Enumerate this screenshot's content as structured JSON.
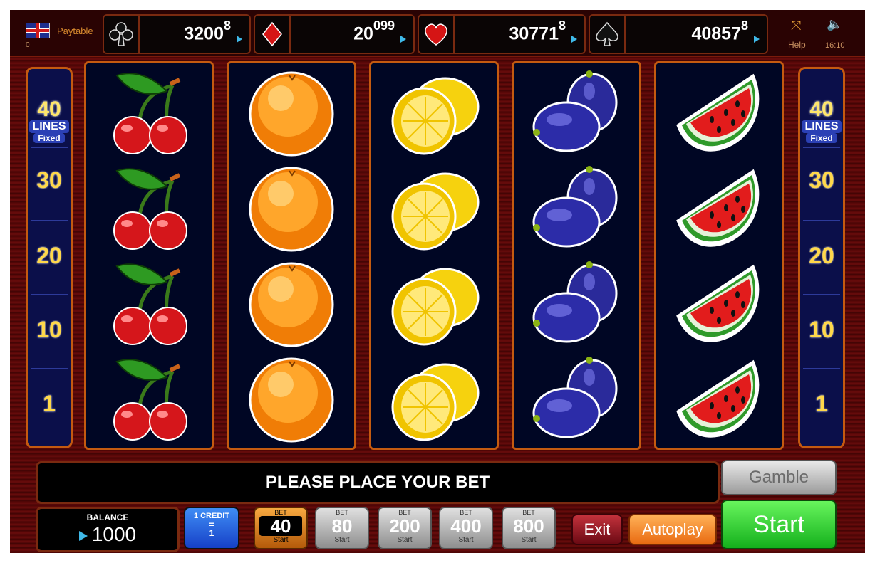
{
  "header": {
    "paytable_label": "Paytable",
    "credit_small": "0",
    "help_label": "Help",
    "time": "16:10",
    "fullscreen_icon": "fullscreen-icon",
    "sound_icon": "speaker-icon"
  },
  "jackpots": [
    {
      "suit": "club",
      "main": "3200",
      "sup": "8"
    },
    {
      "suit": "diamond",
      "main": "20",
      "sup": "099"
    },
    {
      "suit": "heart",
      "main": "30771",
      "sup": "8"
    },
    {
      "suit": "spade",
      "main": "40857",
      "sup": "8"
    }
  ],
  "lines_panel": {
    "top_number": "40",
    "lines_label": "LINES",
    "fixed_label": "Fixed",
    "levels": [
      "30",
      "20",
      "10",
      "1"
    ]
  },
  "reels": [
    {
      "symbol": "cherry"
    },
    {
      "symbol": "orange"
    },
    {
      "symbol": "lemon"
    },
    {
      "symbol": "plum"
    },
    {
      "symbol": "watermelon"
    }
  ],
  "message": "PLEASE PLACE YOUR BET",
  "balance": {
    "label": "BALANCE",
    "value": "1000"
  },
  "credit": {
    "label": "1 CREDIT",
    "eq": "=",
    "value": "1"
  },
  "bets": [
    {
      "top": "BET",
      "value": "40",
      "sub": "Start",
      "active": true
    },
    {
      "top": "BET",
      "value": "80",
      "sub": "Start",
      "active": false
    },
    {
      "top": "BET",
      "value": "200",
      "sub": "Start",
      "active": false
    },
    {
      "top": "BET",
      "value": "400",
      "sub": "Start",
      "active": false
    },
    {
      "top": "BET",
      "value": "800",
      "sub": "Start",
      "active": false
    }
  ],
  "buttons": {
    "gamble": "Gamble",
    "exit": "Exit",
    "autoplay": "Autoplay",
    "start": "Start"
  },
  "colors": {
    "accent": "#c45a10",
    "reel_bg": "#000624",
    "start_green": "#14b01c"
  }
}
